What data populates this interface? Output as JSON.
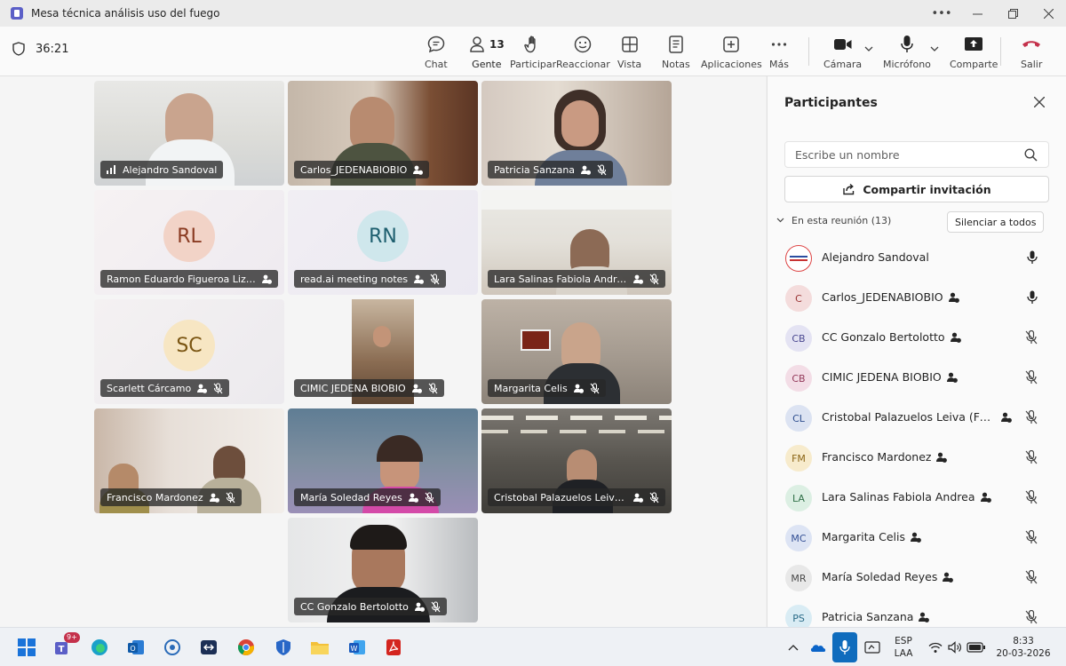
{
  "window": {
    "title": "Mesa técnica análisis uso del fuego"
  },
  "toolbar": {
    "timer": "36:21",
    "chat_label": "Chat",
    "people_label": "Gente",
    "people_count": "13",
    "raise_label": "Participar",
    "react_label": "Reaccionar",
    "view_label": "Vista",
    "notes_label": "Notas",
    "apps_label": "Aplicaciones",
    "more_label": "Más",
    "camera_label": "Cámara",
    "mic_label": "Micrófono",
    "share_label": "Comparte",
    "leave_label": "Salir"
  },
  "tiles": [
    {
      "name": "Alejandro Sandoval",
      "kind": "video"
    },
    {
      "name": "Carlos_JEDENABIOBIO",
      "kind": "video"
    },
    {
      "name": "Patricia Sanzana",
      "kind": "video"
    },
    {
      "name": "Ramon Eduardo Figueroa Lizana",
      "kind": "avatar",
      "initials": "RL"
    },
    {
      "name": "read.ai meeting notes",
      "kind": "avatar",
      "initials": "RN"
    },
    {
      "name": "Lara Salinas Fabiola Andrea",
      "kind": "video"
    },
    {
      "name": "Scarlett Cárcamo",
      "kind": "avatar",
      "initials": "SC"
    },
    {
      "name": "CIMIC JEDENA BIOBIO",
      "kind": "video"
    },
    {
      "name": "Margarita Celis",
      "kind": "video"
    },
    {
      "name": "Francisco Mardonez",
      "kind": "video"
    },
    {
      "name": "María Soledad Reyes",
      "kind": "video"
    },
    {
      "name": "Cristobal Palazuelos Leiva ...",
      "kind": "video"
    },
    {
      "name": "CC Gonzalo Bertolotto",
      "kind": "video"
    }
  ],
  "panel": {
    "title": "Participantes",
    "search_placeholder": "Escribe un nombre",
    "invite_label": "Compartir invitación",
    "section_label": "En esta reunión (13)",
    "mute_all_label": "Silenciar a todos",
    "participants": [
      {
        "initials": "",
        "name": "Alejandro Sandoval",
        "mic": "on",
        "guest": false
      },
      {
        "initials": "C",
        "name": "Carlos_JEDENABIOBIO",
        "mic": "on",
        "guest": true
      },
      {
        "initials": "CB",
        "name": "CC Gonzalo Bertolotto",
        "mic": "muted",
        "guest": true
      },
      {
        "initials": "CB",
        "name": "CIMIC JEDENA BIOBIO",
        "mic": "muted",
        "guest": true
      },
      {
        "initials": "CL",
        "name": "Cristobal Palazuelos Leiva (Forestal Arauco)",
        "mic": "muted",
        "guest": true
      },
      {
        "initials": "FM",
        "name": "Francisco Mardonez",
        "mic": "muted",
        "guest": true
      },
      {
        "initials": "LA",
        "name": "Lara Salinas Fabiola Andrea",
        "mic": "muted",
        "guest": true
      },
      {
        "initials": "MC",
        "name": "Margarita Celis",
        "mic": "muted",
        "guest": true
      },
      {
        "initials": "MR",
        "name": "María Soledad Reyes",
        "mic": "muted",
        "guest": true
      },
      {
        "initials": "PS",
        "name": "Patricia Sanzana",
        "mic": "muted",
        "guest": true
      }
    ]
  },
  "taskbar": {
    "teams_badge": "9+",
    "lang_line1": "ESP",
    "lang_line2": "LAA",
    "time": "8:33",
    "date": "20-03-2026"
  }
}
